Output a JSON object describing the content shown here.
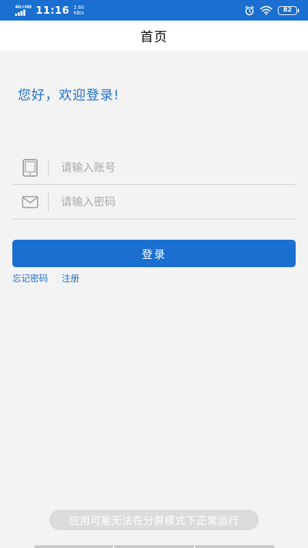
{
  "status_bar": {
    "network": "4G+HD",
    "time": "11:16",
    "speed_value": "2.60",
    "speed_unit": "KB/s",
    "battery": "82",
    "icons": [
      "signal-icon",
      "alarm-icon",
      "wifi-icon",
      "battery-icon"
    ]
  },
  "header": {
    "title": "首页"
  },
  "greeting": "您好，欢迎登录!",
  "form": {
    "account_placeholder": "请输入账号",
    "account_value": "",
    "password_placeholder": "请输入密码",
    "password_value": "",
    "login_label": "登录",
    "forgot_label": "忘记密码",
    "register_label": "注册"
  },
  "toast": "应用可能无法在分屏模式下正常运行",
  "colors": {
    "accent": "#1a6fd0",
    "background": "#f3f3f3"
  }
}
